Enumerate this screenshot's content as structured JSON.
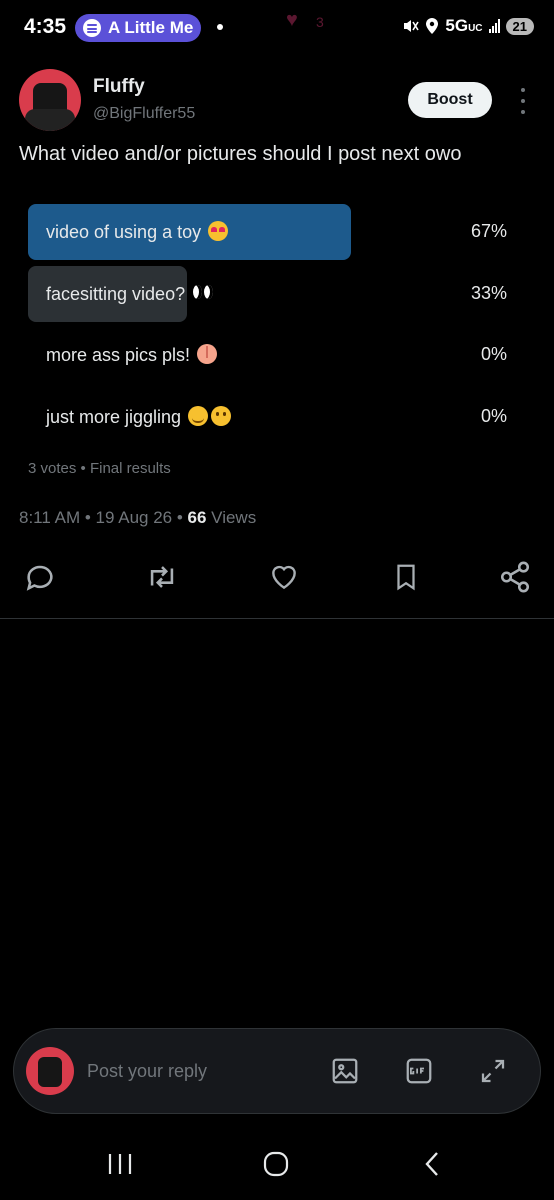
{
  "status_bar": {
    "time": "4:35",
    "media_title": "A Little Me",
    "network": "5G",
    "network_sub": "UC",
    "notification_count": "3",
    "battery": "21"
  },
  "post": {
    "author_name": "Fluffy",
    "author_handle": "@BigFluffer55",
    "boost_label": "Boost",
    "text": "What video and/or pictures should I post next owo",
    "poll": {
      "options": [
        {
          "label": "video of using a toy",
          "emoji": "heart-eyes-emoji",
          "percent": "67%",
          "fraction": 0.67,
          "winner": true
        },
        {
          "label": "facesitting video?",
          "emoji": "eyes-emoji",
          "percent": "33%",
          "fraction": 0.33,
          "winner": false
        },
        {
          "label": "more ass pics pls!",
          "emoji": "peach-emoji",
          "percent": "0%",
          "fraction": 0,
          "winner": false
        },
        {
          "label": "just more jiggling",
          "emoji": "blush-woozy-emoji",
          "percent": "0%",
          "fraction": 0,
          "winner": false
        }
      ],
      "footer": "3 votes • Final results"
    },
    "time": "8:11 AM",
    "date": "19 Aug 26",
    "views_count": "66",
    "views_label": "Views"
  },
  "reply": {
    "placeholder": "Post your reply"
  },
  "colors": {
    "background": "#000000",
    "winner_bar": "#1d5a8c",
    "loser_bar": "#2c3135",
    "boost_bg": "#eff3f4"
  }
}
